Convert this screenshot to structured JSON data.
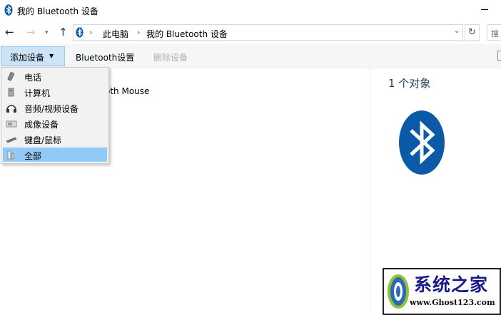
{
  "window": {
    "title": "我的 Bluetooth 设备"
  },
  "address": {
    "crumbs": [
      "此电脑",
      "我的 Bluetooth 设备"
    ],
    "separator": "›",
    "search_stub": "搜"
  },
  "toolbar": {
    "add_device": "添加设备",
    "bluetooth_settings": "Bluetooth设置",
    "remove_device": "删除设备"
  },
  "content": {
    "device_name_partial": "oth Mouse",
    "object_count": "1 个对象"
  },
  "menu": {
    "items": [
      {
        "label": "电话",
        "icon": "phone-icon"
      },
      {
        "label": "计算机",
        "icon": "computer-icon"
      },
      {
        "label": "音频/视频设备",
        "icon": "headphones-icon"
      },
      {
        "label": "成像设备",
        "icon": "scanner-icon"
      },
      {
        "label": "键盘/鼠标",
        "icon": "keyboard-icon"
      },
      {
        "label": "全部",
        "icon": "all-devices-icon",
        "selected": true
      }
    ]
  },
  "watermark": {
    "title": "系统之家",
    "url": "www.Ghost123.com"
  },
  "colors": {
    "bluetooth": "#0a5aa8",
    "selected": "#91c9f7",
    "add_button": "#cce4f7"
  }
}
